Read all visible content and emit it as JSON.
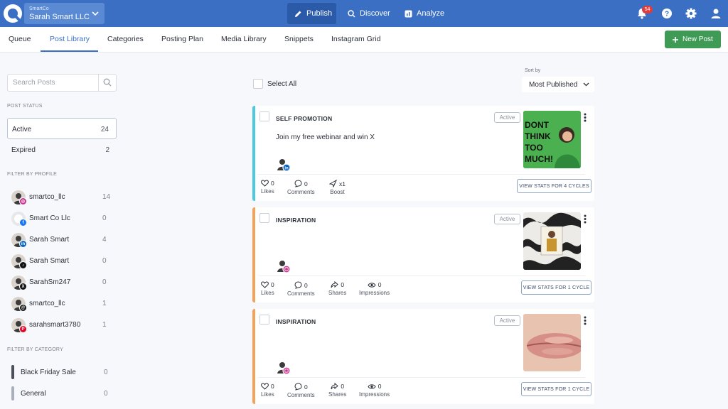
{
  "header": {
    "workspace_small": "SmartCo",
    "workspace_name": "Sarah Smart LLC",
    "nav": [
      {
        "label": "Publish",
        "icon": "pencil-icon",
        "active": true
      },
      {
        "label": "Discover",
        "icon": "search-icon",
        "active": false
      },
      {
        "label": "Analyze",
        "icon": "chart-icon",
        "active": false
      }
    ],
    "notification_count": "54"
  },
  "tabs": [
    "Queue",
    "Post Library",
    "Categories",
    "Posting Plan",
    "Media Library",
    "Snippets",
    "Instagram Grid"
  ],
  "active_tab": "Post Library",
  "new_post_label": "New Post",
  "sidebar": {
    "search_placeholder": "Search Posts",
    "post_status_title": "POST STATUS",
    "statuses": [
      {
        "label": "Active",
        "count": "24"
      },
      {
        "label": "Expired",
        "count": "2"
      }
    ],
    "profile_filter_title": "FILTER BY PROFILE",
    "profiles": [
      {
        "name": "smartco_llc",
        "count": "14",
        "network": "instagram",
        "color": "#c8368f"
      },
      {
        "name": "Smart Co Llc",
        "count": "0",
        "network": "facebook",
        "color": "#1877f2"
      },
      {
        "name": "Sarah Smart",
        "count": "4",
        "network": "linkedin",
        "color": "#0a66c2"
      },
      {
        "name": "Sarah Smart",
        "count": "0",
        "network": "tiktok",
        "color": "#111111"
      },
      {
        "name": "SarahSm247",
        "count": "0",
        "network": "x",
        "color": "#111111"
      },
      {
        "name": "smartco_llc",
        "count": "1",
        "network": "threads",
        "color": "#111111"
      },
      {
        "name": "sarahsmart3780",
        "count": "1",
        "network": "pinterest",
        "color": "#e60023"
      }
    ],
    "category_filter_title": "FILTER BY CATEGORY",
    "categories": [
      {
        "name": "Black Friday Sale",
        "count": "0",
        "color": "#4a4f5a"
      },
      {
        "name": "General",
        "count": "0",
        "color": "#a9b0bb"
      }
    ]
  },
  "main": {
    "select_all_label": "Select All",
    "sort_label": "Sort by",
    "sort_value": "Most Published",
    "posts": [
      {
        "category": "SELF PROMOTION",
        "text": "Join my free webinar and win X",
        "status": "Active",
        "accent": "#4cc9e0",
        "network": "linkedin",
        "thumb_text": "DONT THINK TOO MUCH!",
        "metrics": [
          {
            "value": "0",
            "label": "Likes",
            "icon": "heart-icon"
          },
          {
            "value": "0",
            "label": "Comments",
            "icon": "comment-icon"
          },
          {
            "value": "x1",
            "label": "Boost",
            "icon": "boost-icon"
          }
        ],
        "stats_label": "VIEW STATS FOR 4 CYCLES"
      },
      {
        "category": "INSPIRATION",
        "text": "",
        "status": "Active",
        "accent": "#f3a35a",
        "network": "instagram",
        "metrics": [
          {
            "value": "0",
            "label": "Likes",
            "icon": "heart-icon"
          },
          {
            "value": "0",
            "label": "Comments",
            "icon": "comment-icon"
          },
          {
            "value": "0",
            "label": "Shares",
            "icon": "share-icon"
          },
          {
            "value": "0",
            "label": "Impressions",
            "icon": "eye-icon"
          }
        ],
        "stats_label": "VIEW STATS FOR 1 CYCLE"
      },
      {
        "category": "INSPIRATION",
        "text": "",
        "status": "Active",
        "accent": "#f3a35a",
        "network": "instagram",
        "metrics": [
          {
            "value": "0",
            "label": "Likes",
            "icon": "heart-icon"
          },
          {
            "value": "0",
            "label": "Comments",
            "icon": "comment-icon"
          },
          {
            "value": "0",
            "label": "Shares",
            "icon": "share-icon"
          },
          {
            "value": "0",
            "label": "Impressions",
            "icon": "eye-icon"
          }
        ],
        "stats_label": "VIEW STATS FOR 1 CYCLE"
      }
    ]
  }
}
